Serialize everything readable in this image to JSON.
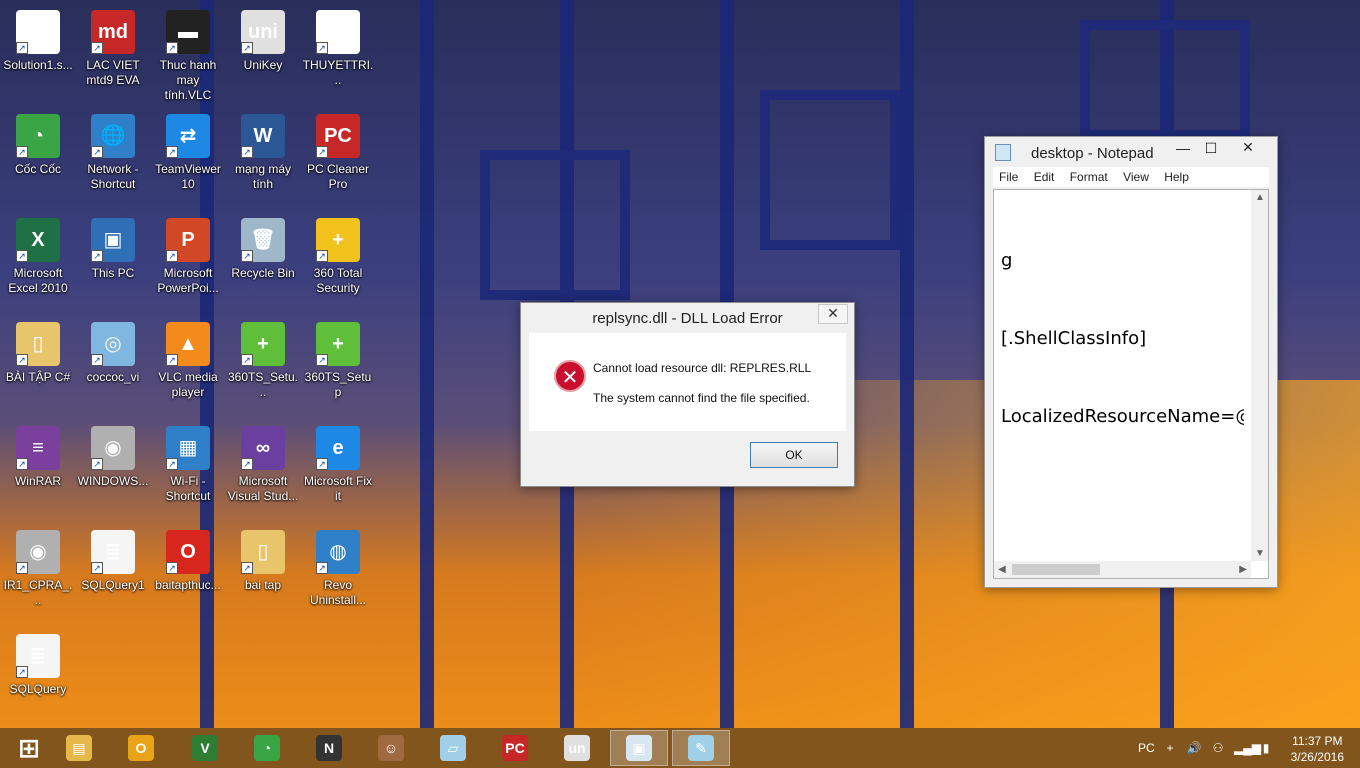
{
  "desktop_icons": [
    {
      "label": "Solution1.s...",
      "icon": "document-icon",
      "color": "#ffffff",
      "glyph": ""
    },
    {
      "label": "LAC VIET mtd9 EVA",
      "icon": "lacviet-dictionary-icon",
      "color": "#c62828",
      "glyph": "md"
    },
    {
      "label": "Thuc hanh may tính.VLC",
      "icon": "video-file-icon",
      "color": "#222222",
      "glyph": "▬"
    },
    {
      "label": "UniKey",
      "icon": "unikey-icon",
      "color": "#e0e0e0",
      "glyph": "uni"
    },
    {
      "label": "THUYETTRI...",
      "icon": "presentation-file-icon",
      "color": "#ffffff",
      "glyph": "▭"
    },
    {
      "label": "Cốc Cốc",
      "icon": "coccoc-browser-icon",
      "color": "#3aa545",
      "glyph": "◔"
    },
    {
      "label": "Network - Shortcut",
      "icon": "network-globe-icon",
      "color": "#2f80c9",
      "glyph": "🌐"
    },
    {
      "label": "TeamViewer 10",
      "icon": "teamviewer-icon",
      "color": "#1e88e5",
      "glyph": "⇄"
    },
    {
      "label": "mạng máy tính",
      "icon": "word-document-icon",
      "color": "#2b5797",
      "glyph": "W"
    },
    {
      "label": "PC Cleaner Pro",
      "icon": "pc-cleaner-icon",
      "color": "#c62828",
      "glyph": "PC"
    },
    {
      "label": "Microsoft Excel 2010",
      "icon": "excel-icon",
      "color": "#1e7145",
      "glyph": "X"
    },
    {
      "label": "This PC",
      "icon": "computer-icon",
      "color": "#2f6fb5",
      "glyph": "▣"
    },
    {
      "label": "Microsoft PowerPoi...",
      "icon": "powerpoint-icon",
      "color": "#d24726",
      "glyph": "P"
    },
    {
      "label": "Recycle Bin",
      "icon": "recycle-bin-icon",
      "color": "#9eb7c9",
      "glyph": "🗑"
    },
    {
      "label": "360 Total Security",
      "icon": "360-security-icon",
      "color": "#f2c21c",
      "glyph": "+"
    },
    {
      "label": "BÀI TẬP C#",
      "icon": "folder-icon",
      "color": "#e8c46a",
      "glyph": "▯"
    },
    {
      "label": "coccoc_vi",
      "icon": "installer-disc-icon",
      "color": "#7fb7e0",
      "glyph": "◎"
    },
    {
      "label": "VLC media player",
      "icon": "vlc-cone-icon",
      "color": "#f28a1c",
      "glyph": "▲"
    },
    {
      "label": "360TS_Setu...",
      "icon": "360-setup-icon",
      "color": "#5fbf3a",
      "glyph": "+"
    },
    {
      "label": "360TS_Setup",
      "icon": "360-setup-icon",
      "color": "#5fbf3a",
      "glyph": "+"
    },
    {
      "label": "WinRAR",
      "icon": "winrar-icon",
      "color": "#7b3f9e",
      "glyph": "≡"
    },
    {
      "label": "WINDOWS...",
      "icon": "disc-image-icon",
      "color": "#b0b0b0",
      "glyph": "◉"
    },
    {
      "label": "Wi-Fi - Shortcut",
      "icon": "wifi-network-icon",
      "color": "#2f80c9",
      "glyph": "▦"
    },
    {
      "label": "Microsoft Visual Stud...",
      "icon": "visual-studio-icon",
      "color": "#6b3fa0",
      "glyph": "∞"
    },
    {
      "label": "Microsoft Fix it",
      "icon": "fixit-document-icon",
      "color": "#1e88e5",
      "glyph": "e"
    },
    {
      "label": "IR1_CPRA_...",
      "icon": "disc-image-icon",
      "color": "#b0b0b0",
      "glyph": "◉"
    },
    {
      "label": "SQLQuery1",
      "icon": "text-file-icon",
      "color": "#f5f5f5",
      "glyph": "≣"
    },
    {
      "label": "baitapthuc...",
      "icon": "opera-browser-icon",
      "color": "#d7261e",
      "glyph": "O"
    },
    {
      "label": "bai tap",
      "icon": "folder-icon",
      "color": "#e8c46a",
      "glyph": "▯"
    },
    {
      "label": "Revo Uninstall...",
      "icon": "revo-uninstaller-icon",
      "color": "#2f80c9",
      "glyph": "◍"
    },
    {
      "label": "SQLQuery",
      "icon": "text-file-icon",
      "color": "#f5f5f5",
      "glyph": "≣"
    }
  ],
  "dialog": {
    "title": "replsync.dll - DLL Load Error",
    "close_label": "✕",
    "message_line1": "Cannot load resource dll: REPLRES.RLL",
    "message_line2": "The system cannot find the file specified.",
    "ok_label": "OK",
    "error_glyph": "✕"
  },
  "notepad": {
    "title": "desktop - Notepad",
    "minimize_label": "—",
    "maximize_label": "☐",
    "close_label": "✕",
    "menu": [
      "File",
      "Edit",
      "Format",
      "View",
      "Help"
    ],
    "content": [
      "g",
      "[.ShellClassInfo]",
      "LocalizedResourceName=@%SystemRoot%"
    ]
  },
  "taskbar": {
    "items": [
      {
        "icon": "windows-start-icon",
        "glyph": "⊞",
        "color": "transparent"
      },
      {
        "icon": "file-explorer-icon",
        "glyph": "▤",
        "color": "#e6b84a"
      },
      {
        "icon": "outlook-icon",
        "glyph": "O",
        "color": "#e8a317"
      },
      {
        "icon": "vietnamese-dictionary-icon",
        "glyph": "V",
        "color": "#2e7d32"
      },
      {
        "icon": "coccoc-browser-icon",
        "glyph": "◔",
        "color": "#3aa545"
      },
      {
        "icon": "app-n-icon",
        "glyph": "N",
        "color": "#333333"
      },
      {
        "icon": "user-photo-icon",
        "glyph": "☺",
        "color": "#a06a40"
      },
      {
        "icon": "sticky-notes-icon",
        "glyph": "▱",
        "color": "#9fd0e8"
      },
      {
        "icon": "pc-cleaner-icon",
        "glyph": "PC",
        "color": "#c62828"
      },
      {
        "icon": "unikey-icon",
        "glyph": "un",
        "color": "#e0e0e0"
      },
      {
        "icon": "dialog-window-icon",
        "glyph": "▣",
        "color": "#d8e6f2"
      },
      {
        "icon": "notepad-icon",
        "glyph": "✎",
        "color": "#9fd0e8"
      }
    ],
    "tray_icons": [
      "pc-cleaner-tray-icon",
      "360-security-tray-icon",
      "volume-icon",
      "usb-device-icon",
      "signal-bars-icon",
      "power-battery-icon"
    ],
    "tray_glyphs": [
      "PC",
      "+",
      "🔊",
      "⚇",
      "▂▄▆",
      "▮"
    ],
    "time": "11:37 PM",
    "date": "3/26/2016"
  }
}
